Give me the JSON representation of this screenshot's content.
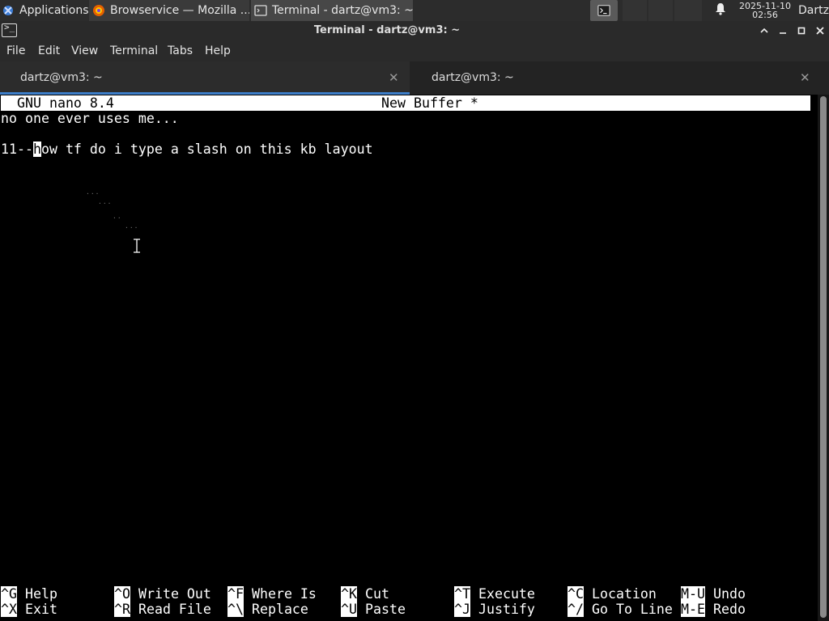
{
  "panel": {
    "applications_label": "Applications",
    "browser_task": "Browservice — Mozilla ...",
    "terminal_task": "Terminal - dartz@vm3: ~",
    "clock_date": "2025-11-10",
    "clock_time": "02:56",
    "user": "Dartz"
  },
  "window": {
    "title": "Terminal - dartz@vm3: ~"
  },
  "menubar": {
    "file": "File",
    "edit": "Edit",
    "view": "View",
    "terminal": "Terminal",
    "tabs": "Tabs",
    "help": "Help"
  },
  "tabs": [
    {
      "label": "dartz@vm3: ~",
      "active": true
    },
    {
      "label": "dartz@vm3: ~",
      "active": false
    }
  ],
  "nano": {
    "version": "GNU nano 8.4",
    "buffer": "New Buffer *",
    "lines": [
      "no one ever uses me...",
      "",
      "11--how tf do i type a slash on this kb layout"
    ],
    "cursor_line_prefix": "11--",
    "cursor_char": "h",
    "cursor_line_rest": "ow tf do i type a slash on this kb layout",
    "shortcuts_row1": [
      {
        "key": "^G",
        "label": "Help"
      },
      {
        "key": "^O",
        "label": "Write Out"
      },
      {
        "key": "^F",
        "label": "Where Is"
      },
      {
        "key": "^K",
        "label": "Cut"
      },
      {
        "key": "^T",
        "label": "Execute"
      },
      {
        "key": "^C",
        "label": "Location"
      },
      {
        "key": "M-U",
        "label": "Undo"
      }
    ],
    "shortcuts_row2": [
      {
        "key": "^X",
        "label": "Exit"
      },
      {
        "key": "^R",
        "label": "Read File"
      },
      {
        "key": "^\\",
        "label": "Replace"
      },
      {
        "key": "^U",
        "label": "Paste"
      },
      {
        "key": "^J",
        "label": "Justify"
      },
      {
        "key": "^/",
        "label": "Go To Line"
      },
      {
        "key": "M-E",
        "label": "Redo"
      }
    ]
  },
  "colors": {
    "panel_bg": "#2c2c2c",
    "titlebar_bg": "#2a2a2a",
    "terminal_bg": "#000000",
    "terminal_fg": "#ffffff",
    "active_tab_underline": "#3d7ec9"
  },
  "icons": {
    "app_menu": "xfce-mouse-icon",
    "browser": "firefox-icon",
    "terminal": "terminal-icon",
    "notifications": "bell-icon",
    "minimize": "minimize-icon",
    "maximize": "maximize-icon",
    "close": "close-icon",
    "collapse": "chevron-up-icon",
    "pointer": "text-cursor-icon"
  }
}
